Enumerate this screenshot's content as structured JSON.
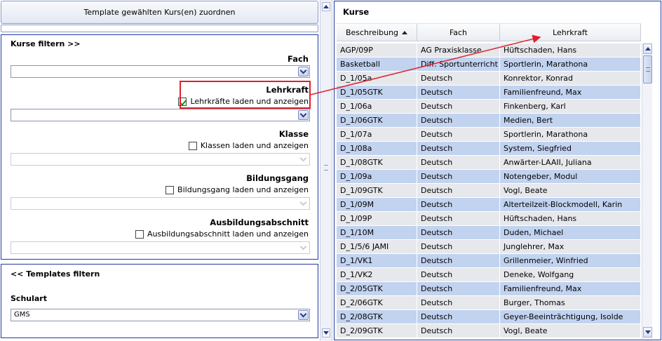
{
  "left": {
    "assign_button": "Template gewählten Kurs(en) zuordnen",
    "filter_panel": {
      "title": "Kurse filtern >>",
      "fach": {
        "label": "Fach",
        "value": ""
      },
      "lehrkraft": {
        "label": "Lehrkraft",
        "checkbox_label": "Lehrkräfte laden und anzeigen",
        "checked": true,
        "value": ""
      },
      "klasse": {
        "label": "Klasse",
        "checkbox_label": "Klassen laden und anzeigen",
        "checked": false,
        "value": ""
      },
      "bildungsgang": {
        "label": "Bildungsgang",
        "checkbox_label": "Bildungsgang laden und anzeigen",
        "checked": false,
        "value": ""
      },
      "ausbildungsabschnitt": {
        "label": "Ausbildungsabschnitt",
        "checkbox_label": "Ausbildungsabschnitt laden und anzeigen",
        "checked": false,
        "value": ""
      }
    },
    "templates_panel": {
      "title": "<< Templates filtern",
      "schulart": {
        "label": "Schulart",
        "value": "GMS"
      }
    }
  },
  "right": {
    "title": "Kurse",
    "columns": [
      "Beschreibung",
      "Fach",
      "Lehrkraft"
    ],
    "sorted_column": "Beschreibung",
    "rows": [
      [
        "AGP/09P",
        "AG Praxisklasse",
        "Hüftschaden, Hans"
      ],
      [
        "Basketball",
        "Diff. Sportunterricht",
        "Sportlerin, Marathona"
      ],
      [
        "D_1/05a",
        "Deutsch",
        "Konrektor, Konrad"
      ],
      [
        "D_1/05GTK",
        "Deutsch",
        "Familienfreund, Max"
      ],
      [
        "D_1/06a",
        "Deutsch",
        "Finkenberg, Karl"
      ],
      [
        "D_1/06GTK",
        "Deutsch",
        "Medien, Bert"
      ],
      [
        "D_1/07a",
        "Deutsch",
        "Sportlerin, Marathona"
      ],
      [
        "D_1/08a",
        "Deutsch",
        "System, Siegfried"
      ],
      [
        "D_1/08GTK",
        "Deutsch",
        "Anwärter-LAAII, Juliana"
      ],
      [
        "D_1/09a",
        "Deutsch",
        "Notengeber, Modul"
      ],
      [
        "D_1/09GTK",
        "Deutsch",
        "Vogl, Beate"
      ],
      [
        "D_1/09M",
        "Deutsch",
        "Alterteilzeit-Blockmodell, Karin"
      ],
      [
        "D_1/09P",
        "Deutsch",
        "Hüftschaden, Hans"
      ],
      [
        "D_1/10M",
        "Deutsch",
        "Duden, Michael"
      ],
      [
        "D_1/5/6 JAMI",
        "Deutsch",
        "Junglehrer, Max"
      ],
      [
        "D_1/VK1",
        "Deutsch",
        "Grillenmeier, Winfried"
      ],
      [
        "D_1/VK2",
        "Deutsch",
        "Deneke, Wolfgang"
      ],
      [
        "D_2/05GTK",
        "Deutsch",
        "Familienfreund, Max"
      ],
      [
        "D_2/06GTK",
        "Deutsch",
        "Burger, Thomas"
      ],
      [
        "D_2/08GTK",
        "Deutsch",
        "Geyer-Beeinträchtigung, Isolde"
      ],
      [
        "D_2/09GTK",
        "Deutsch",
        "Vogl, Beate"
      ]
    ]
  },
  "colors": {
    "panel_border": "#1f3aa0",
    "row_odd": "#e6e8ec",
    "row_even": "#c2d3f0",
    "highlight": "#e0202a"
  }
}
